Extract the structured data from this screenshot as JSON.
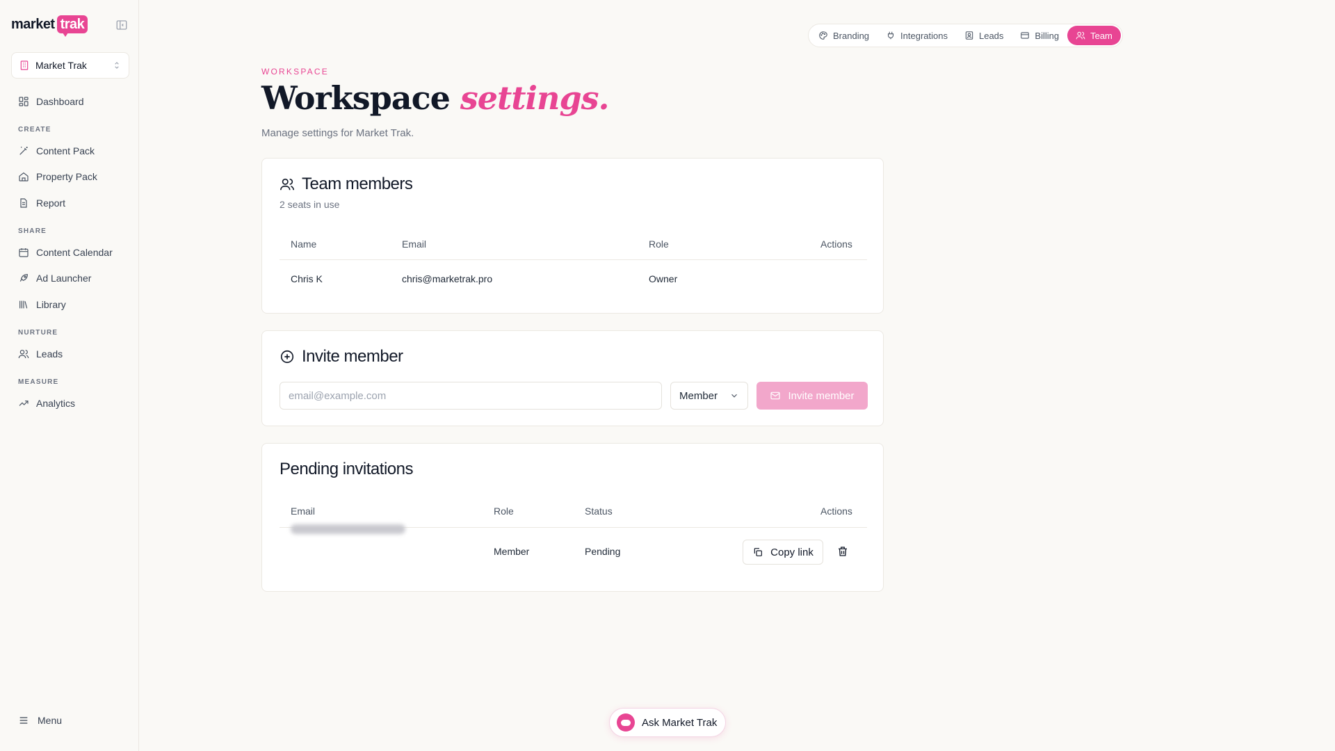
{
  "brand": {
    "word": "market",
    "pill": "trak"
  },
  "workspace_selector": {
    "name": "Market Trak"
  },
  "sidebar": {
    "primary": [
      {
        "label": "Dashboard",
        "icon": "dashboard-icon"
      }
    ],
    "sections": [
      {
        "title": "CREATE",
        "items": [
          {
            "label": "Content Pack",
            "icon": "wand-icon"
          },
          {
            "label": "Property Pack",
            "icon": "home-icon"
          },
          {
            "label": "Report",
            "icon": "document-icon"
          }
        ]
      },
      {
        "title": "SHARE",
        "items": [
          {
            "label": "Content Calendar",
            "icon": "calendar-icon"
          },
          {
            "label": "Ad Launcher",
            "icon": "rocket-icon"
          },
          {
            "label": "Library",
            "icon": "library-icon"
          }
        ]
      },
      {
        "title": "NURTURE",
        "items": [
          {
            "label": "Leads",
            "icon": "users-icon"
          }
        ]
      },
      {
        "title": "MEASURE",
        "items": [
          {
            "label": "Analytics",
            "icon": "trend-icon"
          }
        ]
      }
    ],
    "menu_label": "Menu"
  },
  "tabs": [
    {
      "label": "Branding",
      "icon": "palette-icon",
      "active": false
    },
    {
      "label": "Integrations",
      "icon": "plug-icon",
      "active": false
    },
    {
      "label": "Leads",
      "icon": "contact-icon",
      "active": false
    },
    {
      "label": "Billing",
      "icon": "card-icon",
      "active": false
    },
    {
      "label": "Team",
      "icon": "users-icon",
      "active": true
    }
  ],
  "header": {
    "eyebrow": "WORKSPACE",
    "title_main": "Workspace",
    "title_accent": "settings.",
    "subtitle": "Manage settings for Market Trak."
  },
  "team_members": {
    "title": "Team members",
    "seats": "2 seats in use",
    "columns": [
      "Name",
      "Email",
      "Role",
      "Actions"
    ],
    "rows": [
      {
        "name": "Chris K",
        "email": "chris@marketrak.pro",
        "role": "Owner"
      }
    ]
  },
  "invite": {
    "title": "Invite member",
    "placeholder": "email@example.com",
    "role": "Member",
    "button": "Invite member"
  },
  "pending": {
    "title": "Pending invitations",
    "columns": [
      "Email",
      "Role",
      "Status",
      "Actions"
    ],
    "rows": [
      {
        "role": "Member",
        "status": "Pending",
        "copy": "Copy link"
      }
    ]
  },
  "assistant": {
    "label": "Ask Market Trak"
  },
  "colors": {
    "accent": "#e84593",
    "accent_soft": "#f2a7cb",
    "background": "#faf9f6"
  }
}
